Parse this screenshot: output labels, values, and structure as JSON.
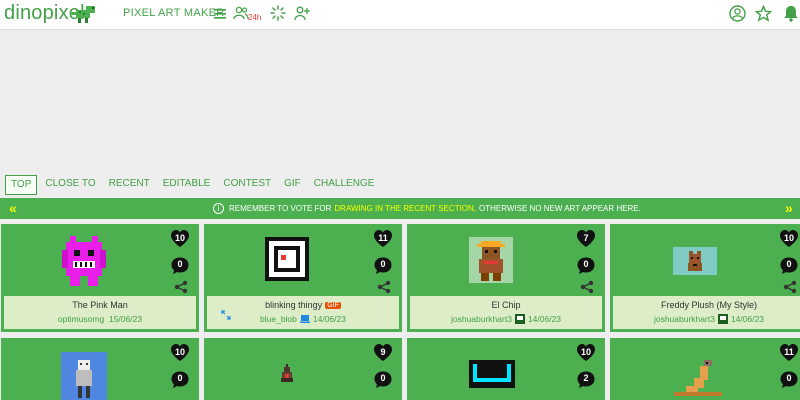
{
  "header": {
    "logo": "dinopixel",
    "app_name": "PIXEL ART MAKER",
    "online_badge": "24h",
    "icons": [
      "menu-icon",
      "users-online-icon",
      "loading-icon",
      "add-user-icon",
      "account-icon",
      "star-icon",
      "bell-icon"
    ]
  },
  "tabs": [
    {
      "label": "TOP",
      "active": true
    },
    {
      "label": "CLOSE TO"
    },
    {
      "label": "RECENT"
    },
    {
      "label": "EDITABLE"
    },
    {
      "label": "CONTEST"
    },
    {
      "label": "GIF"
    },
    {
      "label": "CHALLENGE"
    }
  ],
  "banner": {
    "left_arrow": "«",
    "right_arrow": "»",
    "info_icon": "i",
    "text_before": "REMEMBER TO VOTE FOR",
    "highlight": "DRAWING IN THE RECENT SECTION,",
    "text_after": "OTHERWISE NO NEW ART APPEAR HERE."
  },
  "cards": [
    {
      "title": "The Pink Man",
      "user": "optimusomg",
      "date": "15/06/23",
      "likes": "10",
      "comments": "0"
    },
    {
      "title": "blinking thingy",
      "gif": "GIF",
      "user": "blue_blob",
      "date": "14/06/23",
      "likes": "11",
      "comments": "0"
    },
    {
      "title": "El Chip",
      "user": "joshuaburkhart3",
      "date": "14/06/23",
      "likes": "7",
      "comments": "0"
    },
    {
      "title": "Freddy Plush (My Style)",
      "user": "joshuaburkhart3",
      "date": "14/06/23",
      "likes": "10",
      "comments": "0"
    }
  ],
  "cards_row2": [
    {
      "likes": "10",
      "comments": "0"
    },
    {
      "likes": "9",
      "comments": "0"
    },
    {
      "likes": "10",
      "comments": "2"
    },
    {
      "likes": "11",
      "comments": "0"
    }
  ],
  "colors": {
    "accent": "#43a047",
    "card_bg": "#4caf50",
    "highlight": "#f4ff00",
    "badge_red": "#e53935"
  }
}
